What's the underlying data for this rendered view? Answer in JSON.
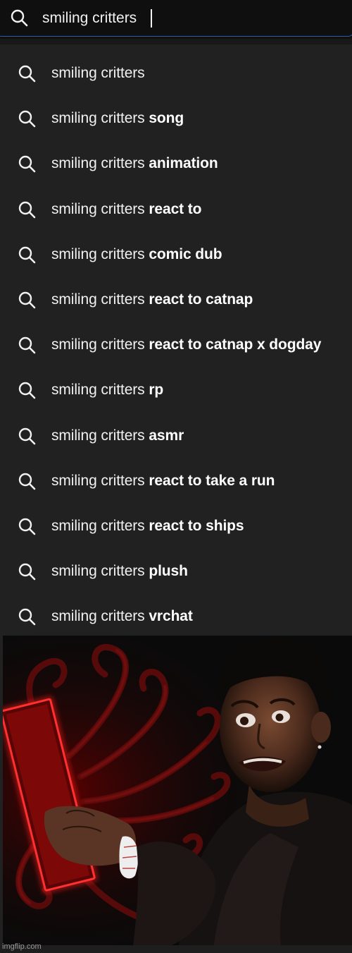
{
  "search": {
    "query": "smiling critters",
    "icon": "search-icon"
  },
  "suggestions": [
    {
      "base": "smiling critters",
      "completion": ""
    },
    {
      "base": "smiling critters",
      "completion": "song"
    },
    {
      "base": "smiling critters",
      "completion": "animation"
    },
    {
      "base": "smiling critters",
      "completion": "react to"
    },
    {
      "base": "smiling critters",
      "completion": "comic dub"
    },
    {
      "base": "smiling critters",
      "completion": "react to catnap"
    },
    {
      "base": "smiling critters",
      "completion": "react to catnap x dogday"
    },
    {
      "base": "smiling critters",
      "completion": "rp"
    },
    {
      "base": "smiling critters",
      "completion": "asmr"
    },
    {
      "base": "smiling critters",
      "completion": "react to take a run"
    },
    {
      "base": "smiling critters",
      "completion": "react to ships"
    },
    {
      "base": "smiling critters",
      "completion": "plush"
    },
    {
      "base": "smiling critters",
      "completion": "vrchat"
    }
  ],
  "watermark": "imgflip.com",
  "colors": {
    "background": "#212121",
    "search_bar": "#0f0f0f",
    "focus_border": "#2d5ca8",
    "text": "#f1f1f1",
    "glow_red": "#ff1a1a"
  }
}
